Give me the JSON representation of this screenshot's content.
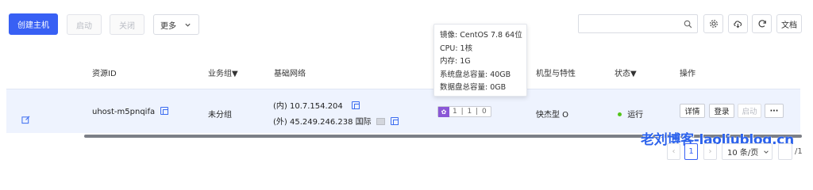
{
  "toolbar": {
    "create_label": "创建主机",
    "start_label": "启动",
    "stop_label": "关闭",
    "more_label": "更多",
    "docs_label": "文档",
    "search_placeholder": ""
  },
  "table": {
    "headers": {
      "resource_id": "资源ID",
      "business_group": "业务组▼",
      "network": "基础网络",
      "model": "机型与特性",
      "status": "状态▼",
      "actions": "操作"
    },
    "row": {
      "resource_id": "uhost-m5pnqifa",
      "business_group": "未分组",
      "private_ip": "(内) 10.7.154.204",
      "public_ip": "(外) 45.249.246.238 国际",
      "config": "1 | 1 | 0",
      "model": "快杰型 O",
      "status": "运行",
      "actions": {
        "details": "详情",
        "login": "登录",
        "start": "启动",
        "more": "···"
      }
    }
  },
  "tooltip": {
    "image": "镜像: CentOS 7.8 64位",
    "cpu": "CPU: 1核",
    "memory": "内存: 1G",
    "system_disk": "系统盘总容量: 40GB",
    "data_disk": "数据盘总容量: 0GB"
  },
  "pagination": {
    "prev": "‹",
    "page": "1",
    "next": "›",
    "page_size": "10 条/页",
    "total": "/1"
  },
  "watermark": "老刘博客-laoliublog.cn",
  "colors": {
    "primary": "#3860f4",
    "row_selected": "#eef3fe",
    "status_running": "#52c41a",
    "gpu_badge": "#8a57d6"
  }
}
